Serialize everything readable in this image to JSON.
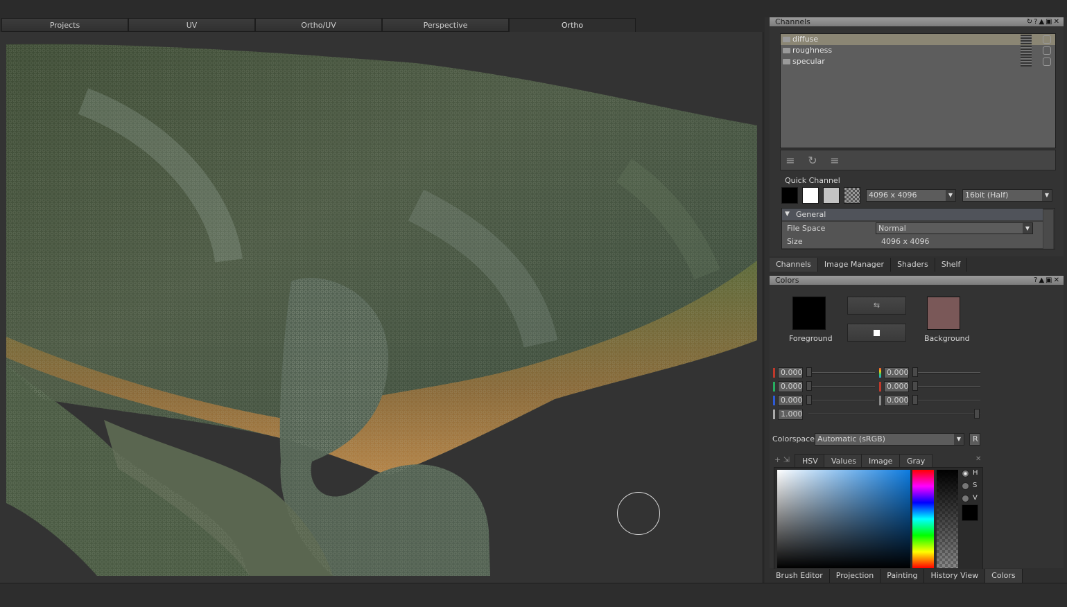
{
  "viewport_tabs": [
    "Projects",
    "UV",
    "Ortho/UV",
    "Perspective",
    "Ortho"
  ],
  "channels_panel": {
    "title": "Channels",
    "channels": [
      {
        "name": "diffuse",
        "selected": true
      },
      {
        "name": "roughness",
        "selected": false
      },
      {
        "name": "specular",
        "selected": false
      }
    ],
    "quick_channel_label": "Quick Channel",
    "resolution": "4096 x 4096",
    "bit_depth": "16bit (Half)",
    "general": {
      "header": "General",
      "file_space_label": "File Space",
      "file_space_value": "Normal",
      "size_label": "Size",
      "size_value": "4096 x 4096"
    },
    "tabs": [
      "Channels",
      "Image Manager",
      "Shaders",
      "Shelf"
    ]
  },
  "colors_panel": {
    "title": "Colors",
    "foreground_label": "Foreground",
    "background_label": "Background",
    "foreground_color": "#000000",
    "background_color": "#7a5858",
    "values_left": [
      "0.000",
      "0.000",
      "0.000"
    ],
    "values_right": [
      "0.000",
      "0.000",
      "0.000"
    ],
    "alpha": "1.000",
    "colorspace_label": "Colorspace",
    "colorspace_value": "Automatic (sRGB)",
    "colorspace_reset": "R",
    "picker_tabs": [
      "HSV",
      "Values",
      "Image",
      "Gray"
    ],
    "radio_labels": [
      "H",
      "S",
      "V"
    ]
  },
  "bottom_tabs": [
    "Brush Editor",
    "Projection",
    "Painting",
    "History View",
    "Colors"
  ]
}
